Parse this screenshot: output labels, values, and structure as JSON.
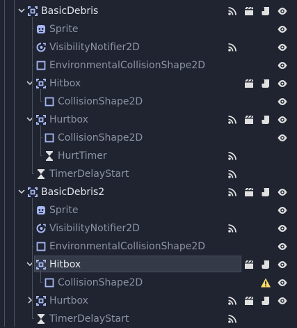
{
  "nodes": [
    {
      "name": "BasicDebris",
      "icon": "node2d-icon",
      "depth": 0,
      "expanded": true,
      "instanced": true,
      "badges": [
        "signals-icon",
        "groups-icon",
        "script-icon",
        "visibility-eye-icon"
      ]
    },
    {
      "name": "Sprite",
      "icon": "sprite-icon",
      "depth": 1,
      "badges": [
        "visibility-eye-icon"
      ]
    },
    {
      "name": "VisibilityNotifier2D",
      "icon": "visibility-notifier-icon",
      "depth": 1,
      "badges": [
        "signals-icon",
        "visibility-eye-icon"
      ]
    },
    {
      "name": "EnvironmentalCollisionShape2D",
      "icon": "collision-shape-icon",
      "depth": 1,
      "badges": [
        "visibility-eye-icon"
      ]
    },
    {
      "name": "Hitbox",
      "icon": "node2d-icon",
      "depth": 1,
      "expanded": true,
      "badges": [
        "groups-icon",
        "script-icon",
        "visibility-eye-icon"
      ]
    },
    {
      "name": "CollisionShape2D",
      "icon": "collision-shape-icon",
      "depth": 2,
      "badges": [
        "visibility-eye-icon"
      ]
    },
    {
      "name": "Hurtbox",
      "icon": "node2d-icon",
      "depth": 1,
      "expanded": true,
      "badges": [
        "signals-icon",
        "groups-icon",
        "script-icon",
        "visibility-eye-icon"
      ]
    },
    {
      "name": "CollisionShape2D",
      "icon": "collision-shape-icon",
      "depth": 2,
      "badges": [
        "visibility-eye-icon"
      ]
    },
    {
      "name": "HurtTimer",
      "icon": "timer-icon",
      "depth": 2,
      "badges": [
        "signals-icon"
      ]
    },
    {
      "name": "TimerDelayStart",
      "icon": "timer-icon",
      "depth": 1,
      "badges": [
        "signals-icon"
      ]
    },
    {
      "name": "BasicDebris2",
      "icon": "node2d-icon",
      "depth": 0,
      "expanded": true,
      "instanced": true,
      "badges": [
        "signals-icon",
        "groups-icon",
        "script-icon",
        "visibility-eye-icon"
      ]
    },
    {
      "name": "Sprite",
      "icon": "sprite-icon",
      "depth": 1,
      "badges": [
        "visibility-eye-icon"
      ]
    },
    {
      "name": "VisibilityNotifier2D",
      "icon": "visibility-notifier-icon",
      "depth": 1,
      "badges": [
        "signals-icon",
        "visibility-eye-icon"
      ]
    },
    {
      "name": "EnvironmentalCollisionShape2D",
      "icon": "collision-shape-icon",
      "depth": 1,
      "badges": [
        "visibility-eye-icon"
      ]
    },
    {
      "name": "Hitbox",
      "icon": "node2d-icon",
      "depth": 1,
      "expanded": true,
      "selected": true,
      "badges": [
        "groups-icon",
        "script-icon",
        "visibility-eye-icon"
      ]
    },
    {
      "name": "CollisionShape2D",
      "icon": "collision-shape-icon",
      "depth": 2,
      "badges": [
        "warning-icon",
        "visibility-eye-icon"
      ]
    },
    {
      "name": "Hurtbox",
      "icon": "node2d-icon",
      "depth": 1,
      "collapsed": true,
      "badges": [
        "signals-icon",
        "groups-icon",
        "script-icon",
        "visibility-eye-icon"
      ]
    },
    {
      "name": "TimerDelayStart",
      "icon": "timer-icon",
      "depth": 1,
      "badges": [
        "signals-icon"
      ]
    }
  ],
  "colors": {
    "background": "#202431",
    "node2d": "#a5b7f3",
    "sprite": "#a5b7f3",
    "text": "#c8ccd4",
    "badge": "#e0e0e0",
    "warning": "#ffdd65",
    "guide": "#4c5160",
    "selection": "#343a48"
  }
}
